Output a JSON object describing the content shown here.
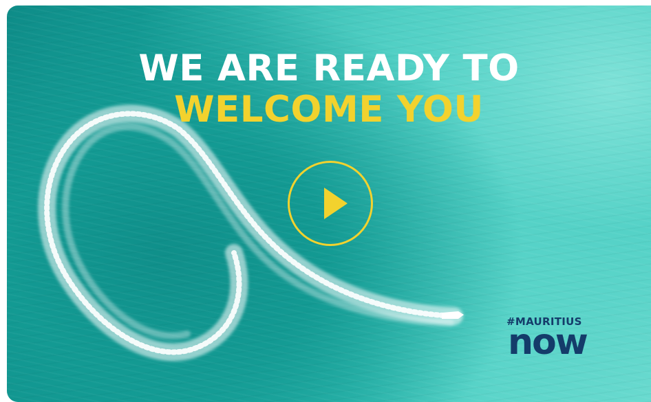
{
  "video": {
    "headline_line1": "WE ARE READY TO",
    "headline_line2": "WELCOME YOU",
    "play_icon": "play-icon",
    "colors": {
      "headline_primary": "#ffffff",
      "headline_accent": "#f2d22e",
      "play_accent": "#f2d22e",
      "brand": "#143c6a",
      "water_deep": "#0f8f8a",
      "water_light": "#6fdcd1"
    }
  },
  "brand": {
    "hashtag": "#MAURITIUS",
    "wordmark": "now"
  }
}
